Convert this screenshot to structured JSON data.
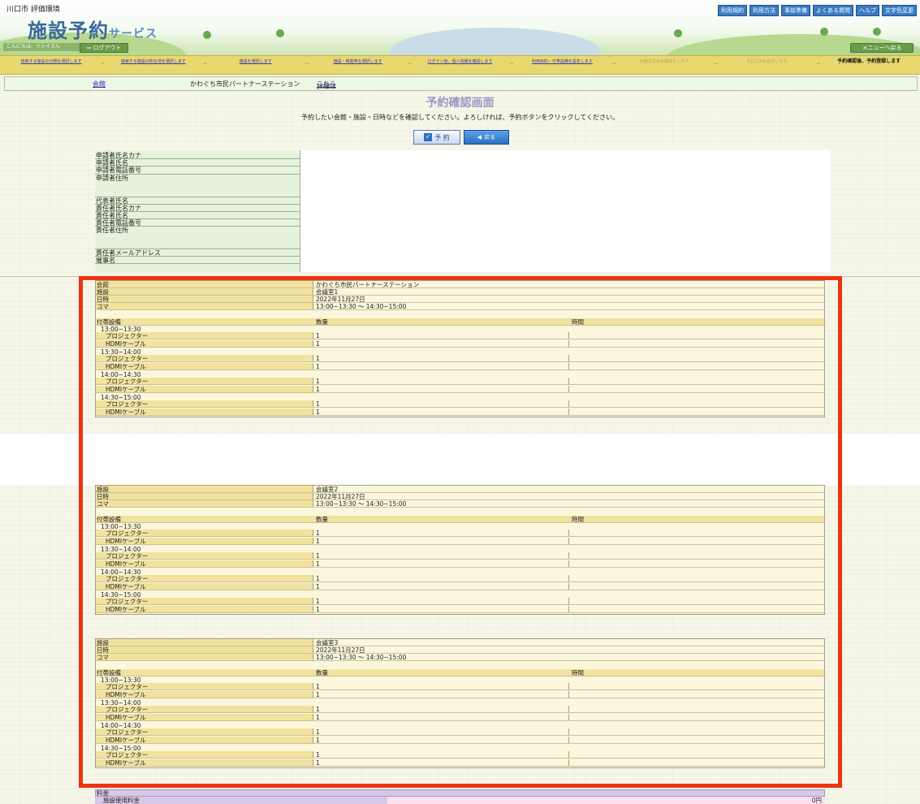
{
  "header": {
    "city": "川口市 評価環境",
    "logo_main": "施設予約",
    "logo_sub": "サービス",
    "greeting": "こんにちは、イシイさん",
    "logout": "ログアウト",
    "menu_back": "メニューへ戻る",
    "top_links": [
      "利用規約",
      "利用方法",
      "事前準備",
      "よくある質問",
      "ヘルプ",
      "文字色変更"
    ]
  },
  "steps": [
    {
      "label": "検索する施設の分類を選択します",
      "state": "link"
    },
    {
      "label": "検索する施設の所在地を選択します",
      "state": "link"
    },
    {
      "label": "施設を選択します",
      "state": "link"
    },
    {
      "label": "施設・時間帯を選択します",
      "state": "link"
    },
    {
      "label": "ログイン後、個人情報を確認します",
      "state": "link"
    },
    {
      "label": "利用目的・付帯設備を設定します",
      "state": "link"
    },
    {
      "label": "料金お支払を確認をします",
      "state": "dim"
    },
    {
      "label": "支払方法を設定します",
      "state": "dim"
    },
    {
      "label": "予約確認後、予約登録します",
      "state": "current"
    }
  ],
  "infobar": {
    "label": "会館",
    "hall": "かわぐち市民パートナーステーション",
    "detail_prefix": "詳細は",
    "detail_link": "こちら"
  },
  "page": {
    "title": "予約確認画面",
    "instruction": "予約したい会館・施設・日時などを確認してください。よろしければ、予約ボタンをクリックしてください。",
    "reserve_button": "予 約",
    "back_button": "戻る"
  },
  "applicant_fields": [
    "申請者氏名カナ",
    "申請者氏名",
    "申請者電話番号",
    "申請者住所",
    "代表者氏名",
    "責任者氏名カナ",
    "責任者氏名",
    "責任者電話番号",
    "責任者住所",
    "責任者メールアドレス",
    "催事名"
  ],
  "labels": {
    "hall": "会館",
    "facility": "施設",
    "datetime": "日時",
    "koma": "コマ",
    "equipment": "付帯設備",
    "quantity": "数量",
    "time": "時間"
  },
  "reservations": [
    {
      "hall": "かわぐち市民パートナーステーション",
      "facility": "会議室1",
      "date": "2022年11月27日",
      "koma": "13:00~13:30 ～ 14:30~15:00",
      "slots": [
        {
          "time": "13:00~13:30",
          "items": [
            {
              "name": "プロジェクター",
              "qty": "1"
            },
            {
              "name": "HDMIケーブル",
              "qty": "1"
            }
          ]
        },
        {
          "time": "13:30~14:00",
          "items": [
            {
              "name": "プロジェクター",
              "qty": "1"
            },
            {
              "name": "HDMIケーブル",
              "qty": "1"
            }
          ]
        },
        {
          "time": "14:00~14:30",
          "items": [
            {
              "name": "プロジェクター",
              "qty": "1"
            },
            {
              "name": "HDMIケーブル",
              "qty": "1"
            }
          ]
        },
        {
          "time": "14:30~15:00",
          "items": [
            {
              "name": "プロジェクター",
              "qty": "1"
            },
            {
              "name": "HDMIケーブル",
              "qty": "1"
            }
          ]
        }
      ]
    },
    {
      "facility": "会議室2",
      "date": "2022年11月27日",
      "koma": "13:00~13:30 ～ 14:30~15:00",
      "slots": [
        {
          "time": "13:00~13:30",
          "items": [
            {
              "name": "プロジェクター",
              "qty": "1"
            },
            {
              "name": "HDMIケーブル",
              "qty": "1"
            }
          ]
        },
        {
          "time": "13:30~14:00",
          "items": [
            {
              "name": "プロジェクター",
              "qty": "1"
            },
            {
              "name": "HDMIケーブル",
              "qty": "1"
            }
          ]
        },
        {
          "time": "14:00~14:30",
          "items": [
            {
              "name": "プロジェクター",
              "qty": "1"
            },
            {
              "name": "HDMIケーブル",
              "qty": "1"
            }
          ]
        },
        {
          "time": "14:30~15:00",
          "items": [
            {
              "name": "プロジェクター",
              "qty": "1"
            },
            {
              "name": "HDMIケーブル",
              "qty": "1"
            }
          ]
        }
      ]
    },
    {
      "facility": "会議室3",
      "date": "2022年11月27日",
      "koma": "13:00~13:30 ～ 14:30~15:00",
      "slots": [
        {
          "time": "13:00~13:30",
          "items": [
            {
              "name": "プロジェクター",
              "qty": "1"
            },
            {
              "name": "HDMIケーブル",
              "qty": "1"
            }
          ]
        },
        {
          "time": "13:30~14:00",
          "items": [
            {
              "name": "プロジェクター",
              "qty": "1"
            },
            {
              "name": "HDMIケーブル",
              "qty": "1"
            }
          ]
        },
        {
          "time": "14:00~14:30",
          "items": [
            {
              "name": "プロジェクター",
              "qty": "1"
            },
            {
              "name": "HDMIケーブル",
              "qty": "1"
            }
          ]
        },
        {
          "time": "14:30~15:00",
          "items": [
            {
              "name": "プロジェクター",
              "qty": "1"
            },
            {
              "name": "HDMIケーブル",
              "qty": "1"
            }
          ]
        }
      ]
    }
  ],
  "fee": {
    "header": "料金",
    "row_label": "施設使用料金",
    "row_value": "0円"
  },
  "colors": {
    "highlight": "#ee3311",
    "label_bg": "#f1e29e",
    "step_bar": "#e8d870"
  }
}
